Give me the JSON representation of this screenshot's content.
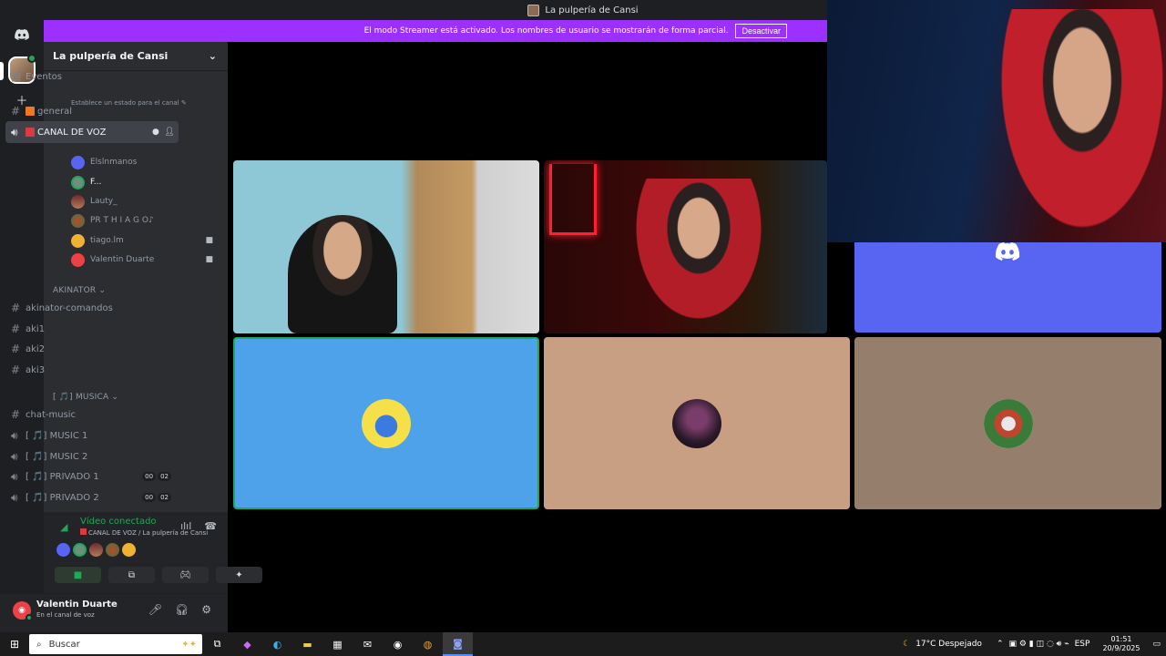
{
  "window": {
    "title": "La pulpería de Cansi"
  },
  "banner": {
    "message": "El modo Streamer está activado. Los nombres de usuario se mostrarán de forma parcial.",
    "button": "Desactivar",
    "color": "#9b30ff"
  },
  "server": {
    "name": "La pulpería de Cansi"
  },
  "channels": {
    "events": "Eventos",
    "general": "general",
    "voice_active": "CANAL DE VOZ",
    "voice_status_hint": "Establece un estado para el canal",
    "voice_users": [
      {
        "name": "Elslnmanos"
      },
      {
        "name": "F..."
      },
      {
        "name": "Lauty_"
      },
      {
        "name": "PR T H I A G O♪"
      },
      {
        "name": "tiago.lm"
      },
      {
        "name": "Valentin Duarte"
      }
    ],
    "cat_akinator": "AKINATOR",
    "akinator": [
      "akinator-comandos",
      "aki1",
      "aki2",
      "aki3"
    ],
    "cat_musica": "[ 🎵] MUSICA",
    "musica_text": "chat-music",
    "musica_voice": [
      {
        "name": "[ 🎵] MUSIC 1"
      },
      {
        "name": "[ 🎵] MUSIC 2"
      },
      {
        "name": "[ 🎵] PRIVADO 1",
        "c1": "00",
        "c2": "02"
      },
      {
        "name": "[ 🎵] PRIVADO 2",
        "c1": "00",
        "c2": "02"
      }
    ]
  },
  "voice_panel": {
    "title": "Vídeo conectado",
    "subtitle": "CANAL DE VOZ / La pulpería de Cansi"
  },
  "user_area": {
    "name": "Valentin Duarte",
    "status": "En el canal de voz"
  },
  "taskbar": {
    "search_placeholder": "Buscar",
    "weather": "17°C  Despejado",
    "lang": "ESP",
    "time": "01:51",
    "date": "20/9/2025"
  },
  "colors": {
    "accent": "#5865f2",
    "online": "#23a55a",
    "tile_blue": "#4ea2ea",
    "tile_tan": "#c99f83",
    "tile_taupe": "#957e6b"
  }
}
